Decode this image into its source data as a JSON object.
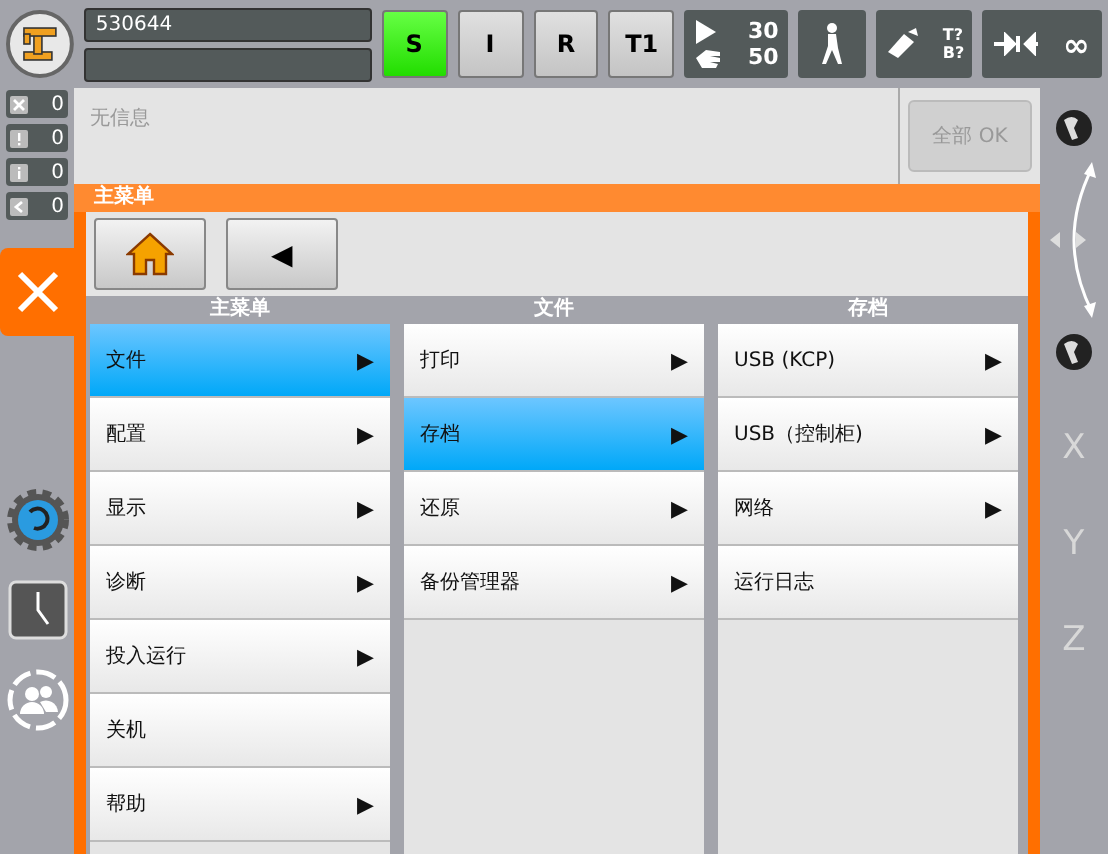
{
  "header": {
    "robot_name": "530644",
    "status_buttons": [
      {
        "label": "S",
        "selected": true
      },
      {
        "label": "I",
        "selected": false
      },
      {
        "label": "R",
        "selected": false
      },
      {
        "label": "T1",
        "selected": false
      }
    ],
    "program_override": "30",
    "manual_override": "50",
    "tool": "T?",
    "base": "B?",
    "increment": "∞"
  },
  "message_counters": [
    {
      "kind": "error",
      "count": "0"
    },
    {
      "kind": "warning",
      "count": "0"
    },
    {
      "kind": "info",
      "count": "0"
    },
    {
      "kind": "dialog",
      "count": "0"
    }
  ],
  "message_window": {
    "text": "无信息",
    "ok_all_button": {
      "label": "全部 OK",
      "disabled": true
    }
  },
  "main_menu": {
    "title": "主菜单",
    "back_button": "◀",
    "columns": [
      {
        "heading": "主菜单",
        "items": [
          {
            "label": "文件",
            "arrow": "▶",
            "selected": true
          },
          {
            "label": "配置",
            "arrow": "▶",
            "selected": false
          },
          {
            "label": "显示",
            "arrow": "▶",
            "selected": false
          },
          {
            "label": "诊断",
            "arrow": "▶",
            "selected": false
          },
          {
            "label": "投入运行",
            "arrow": "▶",
            "selected": false
          },
          {
            "label": "关机",
            "selected": false
          },
          {
            "label": "帮助",
            "arrow": "▶",
            "selected": false
          }
        ]
      },
      {
        "heading": "文件",
        "items": [
          {
            "label": "打印",
            "arrow": "▶",
            "selected": false
          },
          {
            "label": "存档",
            "arrow": "▶",
            "selected": true
          },
          {
            "label": "还原",
            "arrow": "▶",
            "selected": false
          },
          {
            "label": "备份管理器",
            "arrow": "▶",
            "selected": false
          }
        ]
      },
      {
        "heading": "存档",
        "items": [
          {
            "label": "USB (KCP)",
            "arrow": "▶",
            "selected": false
          },
          {
            "label": "USB（控制柜)",
            "arrow": "▶",
            "selected": false
          },
          {
            "label": "网络",
            "arrow": "▶",
            "selected": false
          },
          {
            "label": "运行日志",
            "selected": false
          }
        ]
      }
    ]
  },
  "jog_axes": [
    "X",
    "Y",
    "Z"
  ]
}
